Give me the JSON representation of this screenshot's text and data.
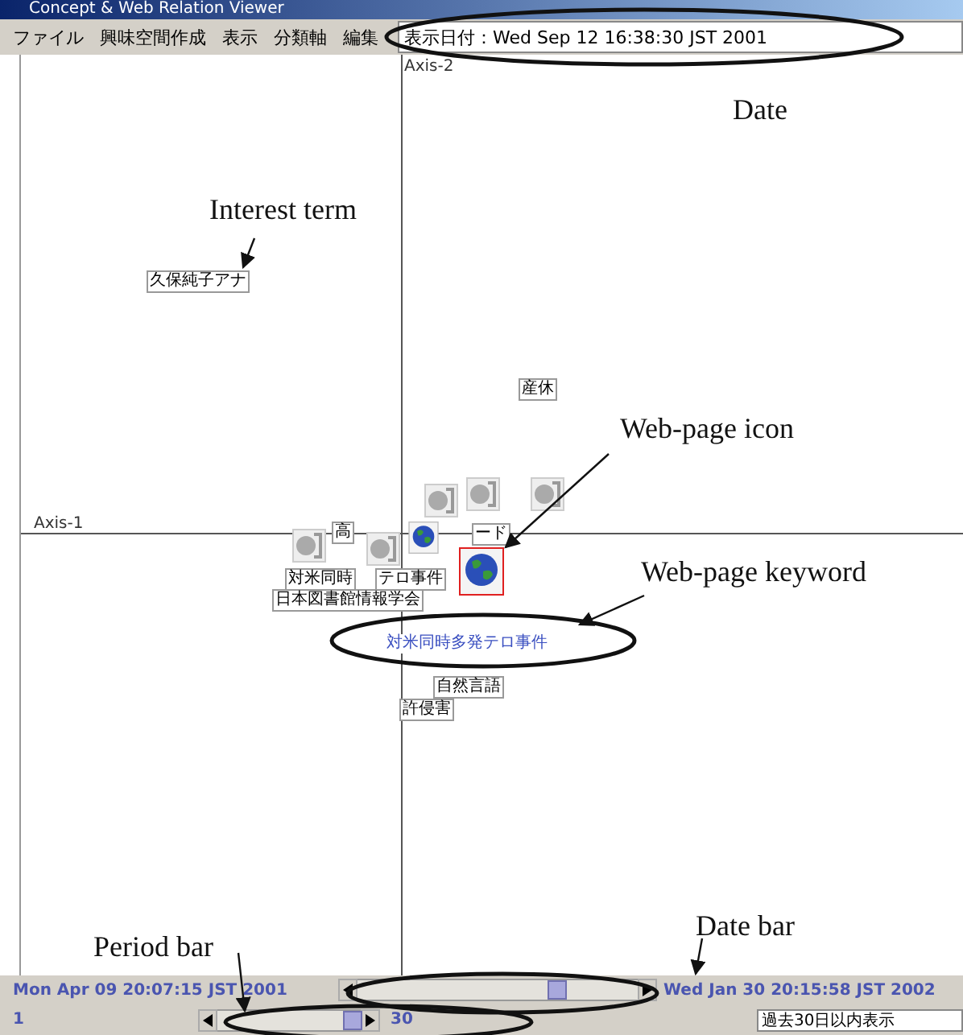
{
  "window": {
    "title": "Concept & Web Relation Viewer"
  },
  "menu": [
    {
      "label": "ファイル"
    },
    {
      "label": "興味空間作成"
    },
    {
      "label": "表示"
    },
    {
      "label": "分類軸"
    },
    {
      "label": "編集"
    }
  ],
  "display_date": "表示日付：Wed Sep 12 16:38:30 JST 2001",
  "axes": {
    "vertical": "Axis-2",
    "horizontal": "Axis-1"
  },
  "terms": [
    {
      "text": "久保純子アナ",
      "kind": "term"
    },
    {
      "text": "産休",
      "kind": "term"
    },
    {
      "text": "高",
      "kind": "term"
    },
    {
      "text": "ード",
      "kind": "term"
    },
    {
      "text": "対米同時",
      "kind": "term"
    },
    {
      "text": "テロ事件",
      "kind": "term"
    },
    {
      "text": "日本図書館情報学会",
      "kind": "term"
    },
    {
      "text": "対米同時多発テロ事件",
      "kind": "keyword"
    },
    {
      "text": "自然言語",
      "kind": "term"
    },
    {
      "text": "許侵害",
      "kind": "term"
    }
  ],
  "web_pages": [
    {
      "kind": "faded",
      "selected": false
    },
    {
      "kind": "faded",
      "selected": false
    },
    {
      "kind": "faded",
      "selected": false
    },
    {
      "kind": "faded",
      "selected": false
    },
    {
      "kind": "faded",
      "selected": false
    },
    {
      "kind": "globe",
      "selected": false
    },
    {
      "kind": "globe",
      "selected": true
    }
  ],
  "date_bar": {
    "start": "Mon Apr 09 20:07:15 JST 2001",
    "end": "Wed Jan 30 20:15:58 JST 2002",
    "level": 0.71
  },
  "period_bar": {
    "min": "1",
    "max": "30",
    "level": 0.95
  },
  "period_field": {
    "value": "過去30日以内表示"
  },
  "annotations": [
    {
      "text": "Date"
    },
    {
      "text": "Interest term"
    },
    {
      "text": "Web-page icon"
    },
    {
      "text": "Web-page keyword"
    },
    {
      "text": "Period bar"
    },
    {
      "text": "Date bar"
    }
  ]
}
